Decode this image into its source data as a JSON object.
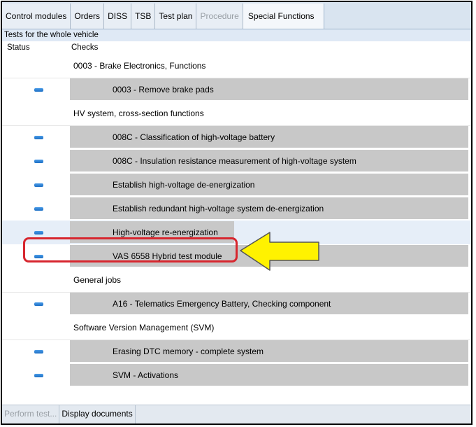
{
  "tabs": [
    {
      "label": "Control modules",
      "state": "normal"
    },
    {
      "label": "Orders",
      "state": "normal"
    },
    {
      "label": "DISS",
      "state": "normal"
    },
    {
      "label": "TSB",
      "state": "normal"
    },
    {
      "label": "Test plan",
      "state": "normal"
    },
    {
      "label": "Procedure",
      "state": "disabled"
    },
    {
      "label": "Special Functions",
      "state": "active"
    }
  ],
  "section_title": "Tests for the whole vehicle",
  "columns": {
    "status": "Status",
    "checks": "Checks"
  },
  "rows": [
    {
      "type": "group",
      "label": "0003 - Brake Electronics, Functions"
    },
    {
      "type": "item",
      "label": "0003  - Remove brake pads",
      "status_icon": "blue-dash-icon"
    },
    {
      "type": "group",
      "label": "HV system, cross-section functions"
    },
    {
      "type": "item",
      "label": "008C  - Classification of high-voltage battery",
      "status_icon": "blue-dash-icon"
    },
    {
      "type": "item",
      "label": "008C  - Insulation resistance measurement of high-voltage system",
      "status_icon": "blue-dash-icon"
    },
    {
      "type": "item",
      "label": "Establish high-voltage de-energization",
      "status_icon": "blue-dash-icon"
    },
    {
      "type": "item",
      "label": "Establish redundant high-voltage system de-energization",
      "status_icon": "blue-dash-icon"
    },
    {
      "type": "item",
      "label": "High-voltage re-energization",
      "status_icon": "blue-dash-icon",
      "selected": true
    },
    {
      "type": "item",
      "label": "VAS 6558 Hybrid test module",
      "status_icon": "blue-dash-icon"
    },
    {
      "type": "group",
      "label": "General jobs"
    },
    {
      "type": "item",
      "label": "A16 - Telematics Emergency Battery, Checking component",
      "status_icon": "blue-dash-icon"
    },
    {
      "type": "group",
      "label": "Software Version Management (SVM)"
    },
    {
      "type": "item",
      "label": "Erasing DTC memory - complete system",
      "status_icon": "blue-dash-icon"
    },
    {
      "type": "item",
      "label": "SVM - Activations",
      "status_icon": "blue-dash-icon"
    }
  ],
  "bottom_buttons": [
    {
      "label": "Perform test...",
      "state": "disabled"
    },
    {
      "label": "Display documents",
      "state": "normal"
    }
  ],
  "annotation": {
    "highlight_color": "#d7262e",
    "arrow_color": "#fff200",
    "arrow_icon": "left-arrow-icon"
  }
}
